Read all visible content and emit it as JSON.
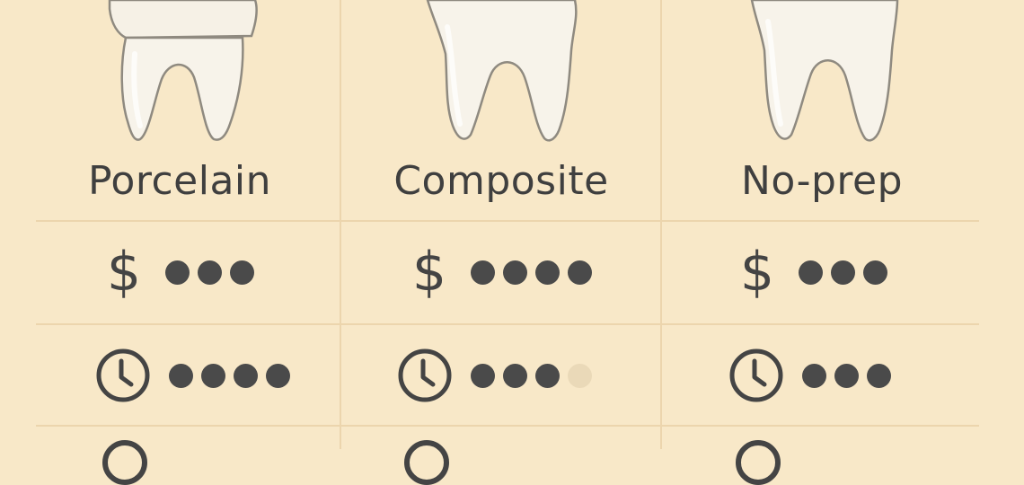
{
  "options": [
    {
      "name": "Porcelain",
      "cost": {
        "icon": "dollar-icon",
        "symbol": "$",
        "filled": 3,
        "total": 3
      },
      "time": {
        "icon": "clock-icon",
        "filled": 4,
        "total": 4
      }
    },
    {
      "name": "Composite",
      "cost": {
        "icon": "dollar-icon",
        "symbol": "$",
        "filled": 4,
        "total": 4
      },
      "time": {
        "icon": "clock-icon",
        "filled": 3,
        "total": 4
      }
    },
    {
      "name": "No-prep",
      "cost": {
        "icon": "dollar-icon",
        "symbol": "$",
        "filled": 3,
        "total": 3
      },
      "time": {
        "icon": "clock-icon",
        "filled": 3,
        "total": 3
      }
    }
  ],
  "colors": {
    "background": "#f8e8c8",
    "grid": "#ecd5ad",
    "dot_filled": "#4a4a4a",
    "dot_empty": "#ead9b8",
    "tooth_fill": "#f7f3ea",
    "tooth_outline": "#8f8a80",
    "text": "#3f3f3f"
  }
}
